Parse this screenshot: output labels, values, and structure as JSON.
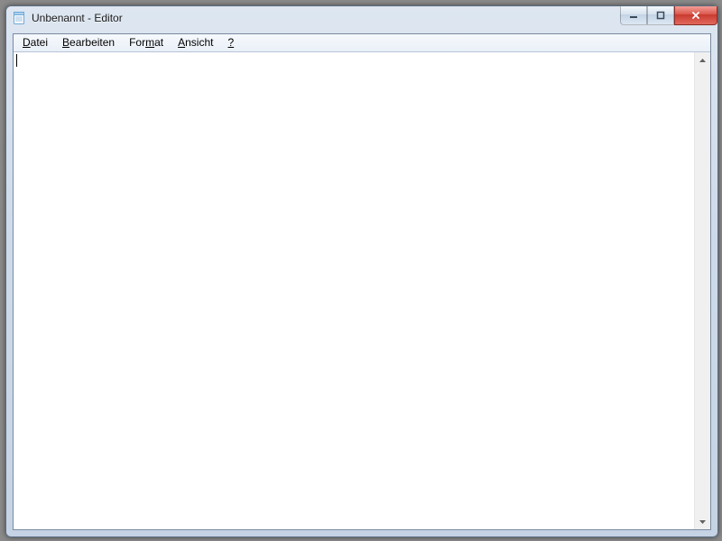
{
  "titlebar": {
    "title": "Unbenannt - Editor"
  },
  "menu": {
    "items": [
      {
        "label": "Datei",
        "accel_index": 0
      },
      {
        "label": "Bearbeiten",
        "accel_index": 0
      },
      {
        "label": "Format",
        "accel_index": 3
      },
      {
        "label": "Ansicht",
        "accel_index": 0
      },
      {
        "label": "?",
        "accel_index": 0
      }
    ]
  },
  "editor": {
    "content": ""
  }
}
